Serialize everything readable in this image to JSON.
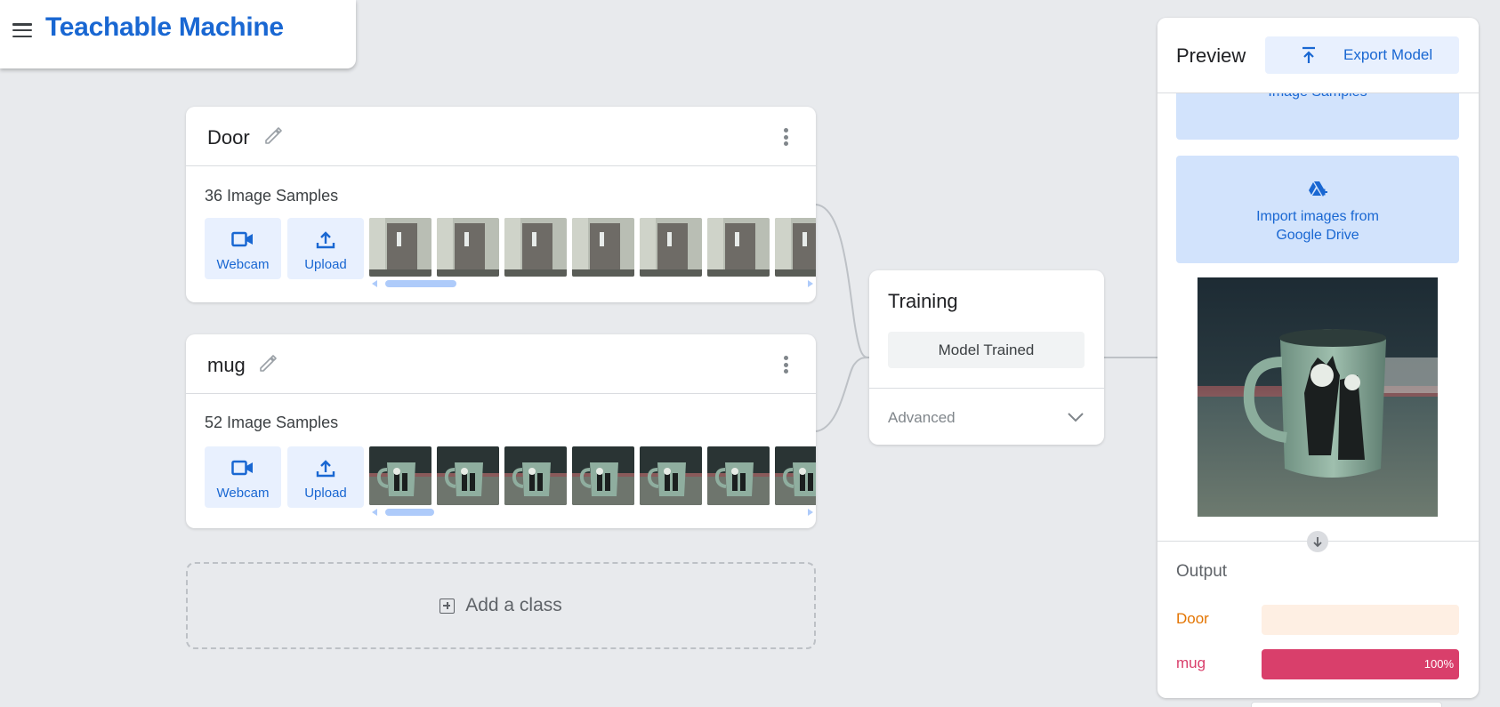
{
  "header": {
    "title": "Teachable Machine",
    "menu_icon": "menu-icon"
  },
  "classes": [
    {
      "name": "Door",
      "samples_label": "36 Image Samples",
      "webcam_label": "Webcam",
      "upload_label": "Upload",
      "thumb_kind": "door",
      "thumb_count": 7,
      "scroll_thumb_fraction": 0.16
    },
    {
      "name": "mug",
      "samples_label": "52 Image Samples",
      "webcam_label": "Webcam",
      "upload_label": "Upload",
      "thumb_kind": "mug",
      "thumb_count": 7,
      "scroll_thumb_fraction": 0.11
    }
  ],
  "add_class": {
    "label": "Add a class"
  },
  "training": {
    "title": "Training",
    "status_button": "Model Trained",
    "advanced_label": "Advanced"
  },
  "preview": {
    "title": "Preview",
    "export_label": "Export Model",
    "partial_button_label": "Image Samples",
    "drive_line1": "Import images from",
    "drive_line2": "Google Drive",
    "output_title": "Output",
    "outputs": [
      {
        "label": "Door",
        "value": 0,
        "color": "#e37400",
        "track": "#feefe3",
        "pct": ""
      },
      {
        "label": "mug",
        "value": 1.0,
        "color": "#d93f6b",
        "track": "#fce4ec",
        "pct": "100%"
      }
    ]
  },
  "colors": {
    "accent": "#1967d2",
    "light_accent": "#e8f0fe"
  }
}
